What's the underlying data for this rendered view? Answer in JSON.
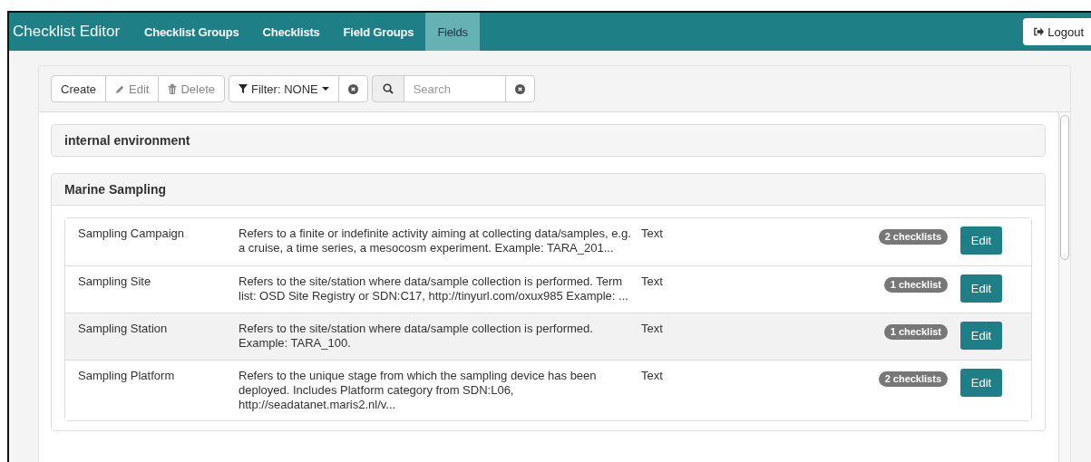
{
  "navbar": {
    "brand": "Checklist Editor",
    "tabs": [
      {
        "label": "Checklist Groups",
        "selected": false
      },
      {
        "label": "Checklists",
        "selected": false
      },
      {
        "label": "Field Groups",
        "selected": false
      },
      {
        "label": "Fields",
        "selected": true
      }
    ],
    "logout": "Logout"
  },
  "toolbar": {
    "actions": [
      {
        "kind": "plain",
        "label": "Create",
        "disabled": false
      },
      {
        "kind": "pencil",
        "label": "Edit",
        "disabled": true
      },
      {
        "kind": "trash",
        "label": "Delete",
        "disabled": true
      }
    ],
    "filter": "Filter: NONE",
    "search": {
      "placeholder": "Search"
    }
  },
  "groups": [
    {
      "title": "internal environment"
    },
    {
      "title": "Marine Sampling",
      "fields": [
        {
          "name": "Sampling Campaign",
          "description": "Refers to a finite or indefinite activity aiming at collecting data/samples, e.g. a cruise, a time series, a mesocosm experiment. Example: TARA_201...",
          "type": "Text",
          "usage": "2 checklists",
          "highlighted": false,
          "action": "Edit"
        },
        {
          "name": "Sampling Site",
          "description": "Refers to the site/station where data/sample collection is performed. Term list: OSD Site Registry or SDN:C17, http://tinyurl.com/oxux985 Example: ...",
          "type": "Text",
          "usage": "1 checklist",
          "highlighted": false,
          "action": "Edit"
        },
        {
          "name": "Sampling Station",
          "description": "Refers to the site/station where data/sample collection is performed. Example: TARA_100.",
          "type": "Text",
          "usage": "1 checklist",
          "highlighted": true,
          "action": "Edit"
        },
        {
          "name": "Sampling Platform",
          "description": "Refers to the unique stage from which the sampling device has been deployed. Includes Platform category from SDN:L06, http://seadatanet.maris2.nl/v...",
          "type": "Text",
          "usage": "2 checklists",
          "highlighted": false,
          "action": "Edit"
        }
      ]
    }
  ]
}
